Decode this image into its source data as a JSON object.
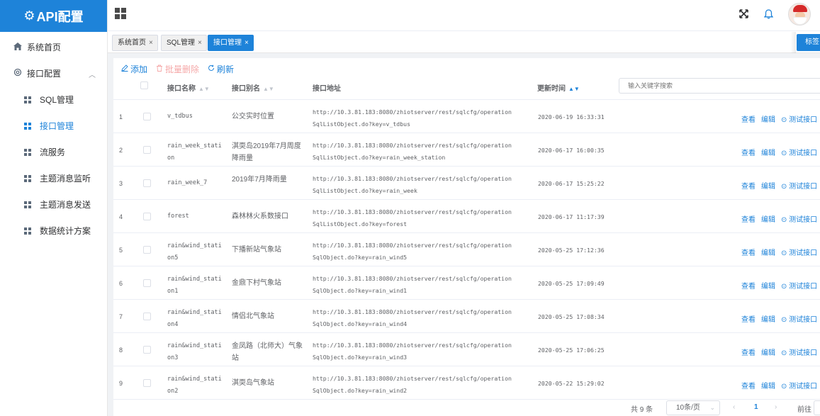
{
  "app": {
    "logo_icon": "⚙",
    "title": "API配置"
  },
  "sidebar": {
    "home": {
      "label": "系统首页",
      "icon": "home-icon"
    },
    "group": {
      "label": "接口配置",
      "icon": "settings-icon",
      "caret": "︿"
    },
    "items": [
      {
        "label": "SQL管理",
        "active": false
      },
      {
        "label": "接口管理",
        "active": true
      },
      {
        "label": "流服务",
        "active": false
      },
      {
        "label": "主题消息监听",
        "active": false
      },
      {
        "label": "主题消息发送",
        "active": false
      },
      {
        "label": "数据统计方案",
        "active": false
      }
    ]
  },
  "header": {
    "fullscreen_icon": "⤧",
    "bell_icon": "🔔"
  },
  "tags": {
    "items": [
      {
        "label": "系统首页",
        "close": "×"
      },
      {
        "label": "SQL管理",
        "close": "×"
      },
      {
        "label": "接口管理",
        "close": "×"
      }
    ],
    "more_label": "标签"
  },
  "toolbar": {
    "add": "添加",
    "batch_delete": "批量删除",
    "refresh": "刷新"
  },
  "search": {
    "placeholder": "输入关键字搜索"
  },
  "table": {
    "columns": {
      "name": "接口名称",
      "alias": "接口别名",
      "url": "接口地址",
      "time": "更新时间"
    },
    "ops": {
      "view": "查看",
      "edit": "编辑",
      "test": "⊙ 测试接口"
    },
    "rows": [
      {
        "idx": "1",
        "name": "v_tdbus",
        "alias": "公交实时位置",
        "url1": "http://10.3.81.183:8080/zhiotserver/rest/sqlcfg/operation",
        "url2": "SqlListObject.do?key=v_tdbus",
        "time": "2020-06-19 16:33:31"
      },
      {
        "idx": "2",
        "name": "rain_week_stati on",
        "alias": "淇耎岛2019年7月周度降雨量",
        "url1": "http://10.3.81.183:8080/zhiotserver/rest/sqlcfg/operation",
        "url2": "SqlListObject.do?key=rain_week_station",
        "time": "2020-06-17 16:00:35"
      },
      {
        "idx": "3",
        "name": "rain_week_7",
        "alias": "2019年7月降雨量",
        "url1": "http://10.3.81.183:8080/zhiotserver/rest/sqlcfg/operation",
        "url2": "SqlListObject.do?key=rain_week",
        "time": "2020-06-17 15:25:22"
      },
      {
        "idx": "4",
        "name": "forest",
        "alias": "森林林火系数接口",
        "url1": "http://10.3.81.183:8080/zhiotserver/rest/sqlcfg/operation",
        "url2": "SqlListObject.do?key=forest",
        "time": "2020-06-17 11:17:39"
      },
      {
        "idx": "5",
        "name": "rain&wind_stati on5",
        "alias": "下播新站气象站",
        "url1": "http://10.3.81.183:8080/zhiotserver/rest/sqlcfg/operation",
        "url2": "SqlObject.do?key=rain_wind5",
        "time": "2020-05-25 17:12:36"
      },
      {
        "idx": "6",
        "name": "rain&wind_stati on1",
        "alias": "金鼎下村气象站",
        "url1": "http://10.3.81.183:8080/zhiotserver/rest/sqlcfg/operation",
        "url2": "SqlObject.do?key=rain_wind1",
        "time": "2020-05-25 17:09:49"
      },
      {
        "idx": "7",
        "name": "rain&wind_stati on4",
        "alias": "情侣北气象站",
        "url1": "http://10.3.81.183:8080/zhiotserver/rest/sqlcfg/operation",
        "url2": "SqlObject.do?key=rain_wind4",
        "time": "2020-05-25 17:08:34"
      },
      {
        "idx": "8",
        "name": "rain&wind_stati on3",
        "alias": "金凤路（北师大）气象站",
        "url1": "http://10.3.81.183:8080/zhiotserver/rest/sqlcfg/operation",
        "url2": "SqlObject.do?key=rain_wind3",
        "time": "2020-05-25 17:06:25"
      },
      {
        "idx": "9",
        "name": "rain&wind_stati on2",
        "alias": "淇耎岛气象站",
        "url1": "http://10.3.81.183:8080/zhiotserver/rest/sqlcfg/operation",
        "url2": "SqlObject.do?key=rain_wind2",
        "time": "2020-05-22 15:29:02"
      }
    ]
  },
  "pagination": {
    "total": "共 9 条",
    "page_size": "10条/页",
    "prev": "‹",
    "current": "1",
    "next": "›",
    "goto": "前往"
  },
  "colors": {
    "accent": "#1e83d9",
    "danger_light": "#f5a8a8"
  }
}
